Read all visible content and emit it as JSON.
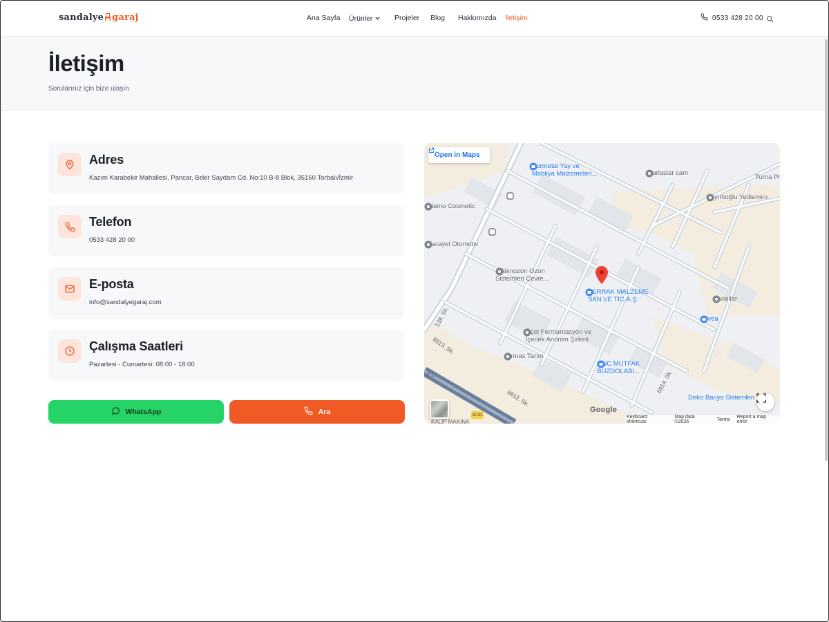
{
  "brand": {
    "name_left": "sandalye",
    "name_right": "garaj",
    "accent": "#f05a28"
  },
  "nav": {
    "items": [
      {
        "label": "Ana Sayfa"
      },
      {
        "label": "Ürünler"
      },
      {
        "label": "Projeler"
      },
      {
        "label": "Blog"
      },
      {
        "label": "Hakkımızda"
      },
      {
        "label": "İletişim"
      }
    ],
    "active": "İletişim",
    "phone": "0533 428 20 00"
  },
  "page": {
    "title": "İletişim",
    "subtitle": "Sorularınız için bize ulaşın"
  },
  "contact": {
    "address": {
      "label": "Adres",
      "value": "Kazım Karabekir Mahallesi, Pancar, Bekir Saydam Cd. No:10 B-8 Blok, 35160 Torbalı/İzmir",
      "icon": "map-pin-icon"
    },
    "phone": {
      "label": "Telefon",
      "value": "0533 428 20 00",
      "icon": "phone-icon"
    },
    "email": {
      "label": "E-posta",
      "value": "info@sandalyegaraj.com",
      "icon": "mail-icon"
    },
    "hours": {
      "label": "Çalışma Saatleri",
      "value": "Pazartesi - Cumartesi: 08:00 - 18:00",
      "icon": "clock-icon"
    }
  },
  "buttons": {
    "whatsapp": "WhatsApp",
    "call": "Ara",
    "whatsapp_color": "#25d366",
    "call_color": "#f05a24"
  },
  "map": {
    "open_label": "Open in Maps",
    "pois": {
      "bormetal_1": "Bormetal Yay ve",
      "bormetal_2": "Mobilya Malzemeleri...",
      "barlaslar": "Barlaslar cam",
      "turna": "Turna Pr",
      "cayirli": "Çayırlıoğlu Yedieminı",
      "diamo": "Diamo Cosmetic",
      "karayel": "eKarayel Otomotiv",
      "teknozon_1": "Teknozon Ozon",
      "teknozon_2": "Sistemleri Çevre...",
      "berrak_1": "BERRAK MALZEME",
      "berrak_2": "SAN.VE TİC.A.Ş",
      "kulalilar": "kulalilar",
      "livea": "Livea",
      "ucel_1": "Üçel Fermantasyon ve",
      "ucel_2": "İçecek Anonim Şirketi",
      "armas": "Armas Tarım",
      "gnc_1": "GNC MUTFAK",
      "gnc_2": "BUZDOLABI...",
      "deko": "Deko Banyo Sistemleri",
      "road_139": "139. Sk.",
      "road_6913a": "6913. Sk.",
      "road_6913b": "6913. Sk.",
      "road_6914": "6914. Sk.",
      "road_o31": "O-31",
      "kalip": "KALIP MAKINA",
      "yel": "YEL"
    },
    "google": "Google",
    "attr": {
      "shortcuts": "Keyboard shortcuts",
      "data": "Map data ©2026",
      "terms": "Terms",
      "report": "Report a map error"
    }
  }
}
